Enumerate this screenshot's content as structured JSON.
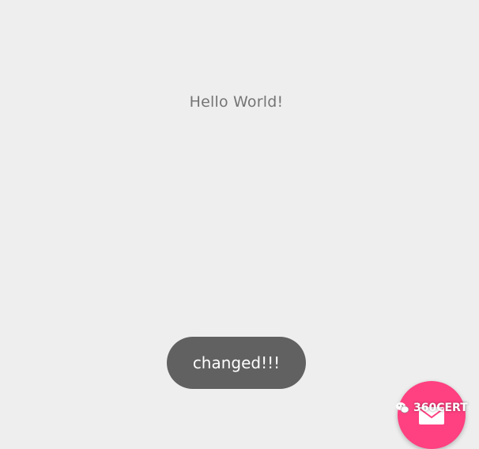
{
  "screen": {
    "title_text": "Hello World!",
    "background_color": "#eeeeee"
  },
  "toast": {
    "message": "changed!!!",
    "background_color": "#616161"
  },
  "fab": {
    "icon": "mail-icon",
    "color": "#ff4081"
  },
  "watermark": {
    "icon": "wechat-icon",
    "text": "360CERT"
  }
}
